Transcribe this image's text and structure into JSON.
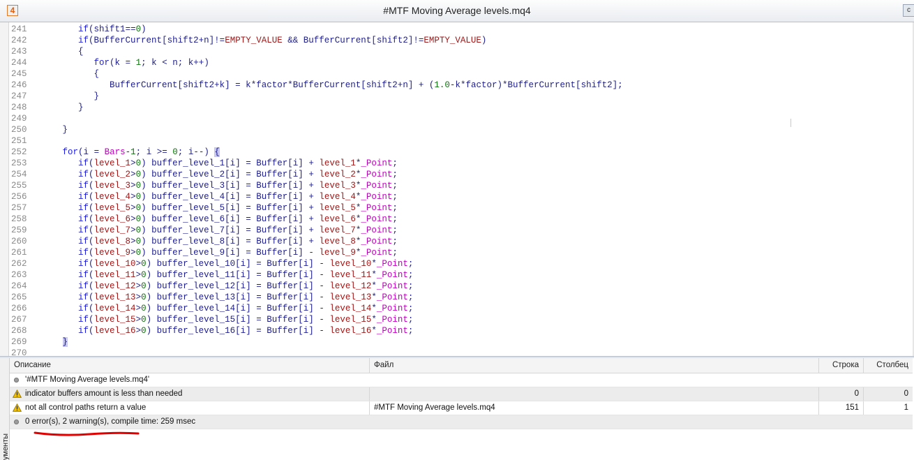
{
  "window": {
    "title": "#MTF Moving Average levels.mq4",
    "app_icon": "4",
    "corner_button": "c"
  },
  "editor": {
    "lines": [
      {
        "n": "241",
        "code": "      if(shift1==0)"
      },
      {
        "n": "242",
        "code": "      if(BufferCurrent[shift2+n]!=EMPTY_VALUE && BufferCurrent[shift2]!=EMPTY_VALUE)"
      },
      {
        "n": "243",
        "code": "      {"
      },
      {
        "n": "244",
        "code": "         for(k = 1; k < n; k++)"
      },
      {
        "n": "245",
        "code": "         {"
      },
      {
        "n": "246",
        "code": "            BufferCurrent[shift2+k] = k*factor*BufferCurrent[shift2+n] + (1.0-k*factor)*BufferCurrent[shift2];"
      },
      {
        "n": "247",
        "code": "         }"
      },
      {
        "n": "248",
        "code": "      }"
      },
      {
        "n": "249",
        "code": ""
      },
      {
        "n": "250",
        "code": "   }"
      },
      {
        "n": "251",
        "code": ""
      },
      {
        "n": "252",
        "code": "   for(i = Bars-1; i >= 0; i--) {"
      },
      {
        "n": "253",
        "code": "      if(level_1>0) buffer_level_1[i] = Buffer[i] + level_1*_Point;"
      },
      {
        "n": "254",
        "code": "      if(level_2>0) buffer_level_2[i] = Buffer[i] + level_2*_Point;"
      },
      {
        "n": "255",
        "code": "      if(level_3>0) buffer_level_3[i] = Buffer[i] + level_3*_Point;"
      },
      {
        "n": "256",
        "code": "      if(level_4>0) buffer_level_4[i] = Buffer[i] + level_4*_Point;"
      },
      {
        "n": "257",
        "code": "      if(level_5>0) buffer_level_5[i] = Buffer[i] + level_5*_Point;"
      },
      {
        "n": "258",
        "code": "      if(level_6>0) buffer_level_6[i] = Buffer[i] + level_6*_Point;"
      },
      {
        "n": "259",
        "code": "      if(level_7>0) buffer_level_7[i] = Buffer[i] + level_7*_Point;"
      },
      {
        "n": "260",
        "code": "      if(level_8>0) buffer_level_8[i] = Buffer[i] + level_8*_Point;"
      },
      {
        "n": "261",
        "code": "      if(level_9>0) buffer_level_9[i] = Buffer[i] - level_9*_Point;"
      },
      {
        "n": "262",
        "code": "      if(level_10>0) buffer_level_10[i] = Buffer[i] - level_10*_Point;"
      },
      {
        "n": "263",
        "code": "      if(level_11>0) buffer_level_11[i] = Buffer[i] - level_11*_Point;"
      },
      {
        "n": "264",
        "code": "      if(level_12>0) buffer_level_12[i] = Buffer[i] - level_12*_Point;"
      },
      {
        "n": "265",
        "code": "      if(level_13>0) buffer_level_13[i] = Buffer[i] - level_13*_Point;"
      },
      {
        "n": "266",
        "code": "      if(level_14>0) buffer_level_14[i] = Buffer[i] - level_14*_Point;"
      },
      {
        "n": "267",
        "code": "      if(level_15>0) buffer_level_15[i] = Buffer[i] - level_15*_Point;"
      },
      {
        "n": "268",
        "code": "      if(level_16>0) buffer_level_16[i] = Buffer[i] - level_16*_Point;"
      },
      {
        "n": "269",
        "code": "   }"
      },
      {
        "n": "270",
        "code": ""
      }
    ]
  },
  "toolbox": {
    "side_tab": "ументы",
    "columns": {
      "description": "Описание",
      "file": "Файл",
      "line": "Строка",
      "column": "Столбец"
    },
    "rows": [
      {
        "type": "info",
        "description": "'#MTF Moving Average levels.mq4'",
        "file": "",
        "line": "",
        "column": ""
      },
      {
        "type": "warning",
        "description": "indicator buffers amount is less than needed",
        "file": "",
        "line": "0",
        "column": "0"
      },
      {
        "type": "warning",
        "description": "not all control paths return a value",
        "file": "#MTF Moving Average levels.mq4",
        "line": "151",
        "column": "1"
      },
      {
        "type": "info",
        "description": "0 error(s), 2 warning(s), compile time: 259 msec",
        "file": "",
        "line": "",
        "column": ""
      }
    ]
  },
  "colors": {
    "keyword": "#1d1de0",
    "identifier": "#1d1d8c",
    "constant": "#a01818",
    "macro": "#c000c0",
    "number": "#107010",
    "warning": "#f2c200",
    "annotation": "#e00000"
  }
}
